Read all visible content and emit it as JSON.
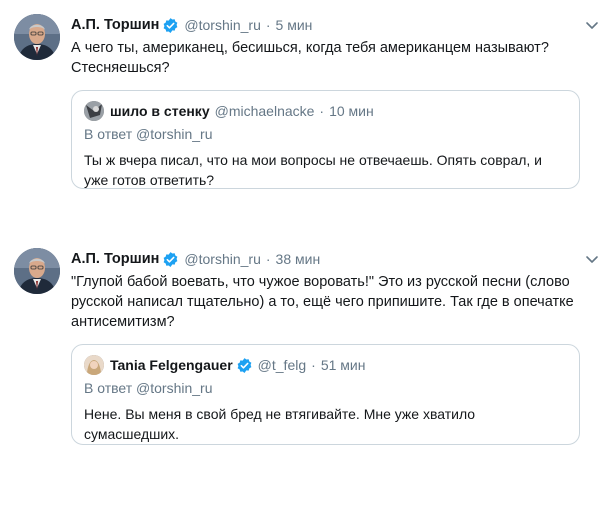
{
  "colors": {
    "accent": "#1da1f2",
    "secondary_text": "#657786",
    "border": "#ccd6dd"
  },
  "tweets": [
    {
      "author_name": "А.П. Торшин",
      "handle": "@torshin_ru",
      "separator": "·",
      "time": "5 мин",
      "text": "А чего ты, американец, бесишься, когда тебя американцем называют? Стесняешься?",
      "quote": {
        "author_name": "шило в стенку",
        "handle": "@michaelnacke",
        "separator": "·",
        "time": "10 мин",
        "reply_to": "В ответ @torshin_ru",
        "text": "Ты ж вчера писал, что на мои вопросы не отвечаешь. Опять соврал, и уже готов ответить?"
      }
    },
    {
      "author_name": "А.П. Торшин",
      "handle": "@torshin_ru",
      "separator": "·",
      "time": "38 мин",
      "text": "\"Глупой бабой воевать, что чужое воровать!\" Это из русской песни (слово русской написал тщательно) а то, ещё чего припишите. Так где в опечатке антисемитизм?",
      "quote": {
        "author_name": "Tania Felgengauer",
        "handle": "@t_felg",
        "separator": "·",
        "time": "51 мин",
        "reply_to": "В ответ @torshin_ru",
        "text": "Нене. Вы меня в свой бред не втягивайте. Мне уже хватило сумасшедших."
      }
    }
  ]
}
